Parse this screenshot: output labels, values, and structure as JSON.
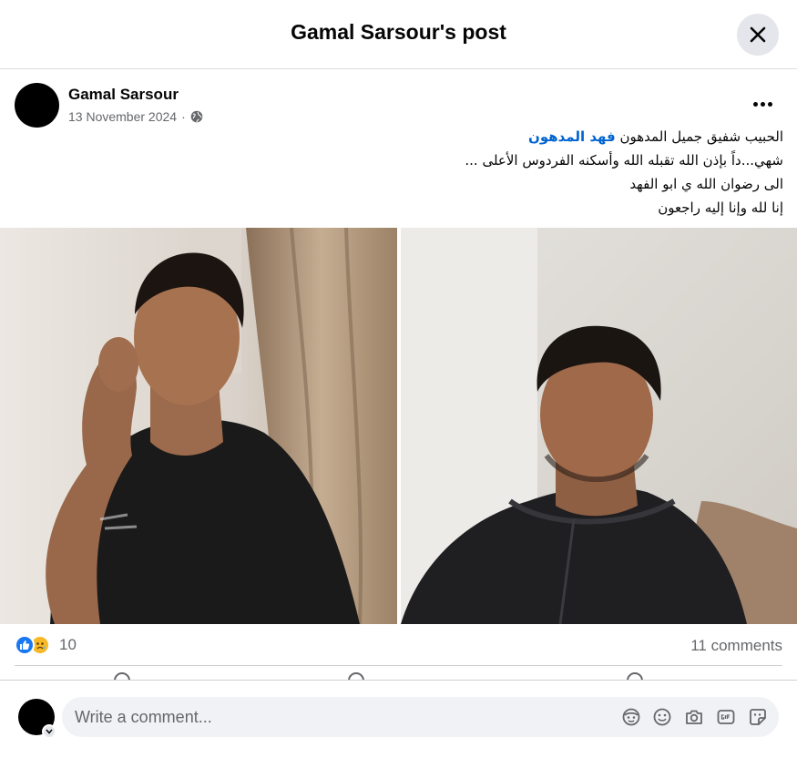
{
  "dialog": {
    "title": "Gamal Sarsour's post"
  },
  "post": {
    "author": "Gamal Sarsour",
    "date": "13 November 2024",
    "separator": "·",
    "privacy_icon": "globe-icon",
    "text_lines": [
      {
        "before": "الحبيب شفيق جميل المدهون ",
        "mention": "فهد المدهون"
      },
      "شهي...داً بإذن الله تقبله الله وأسكنه الفردوس الأعلى ...",
      "الى رضوان الله ي ابو الفهد",
      "إنا لله وإنا إليه راجعون"
    ],
    "photos": [
      {
        "name": "photo-left",
        "subject": "man in black t-shirt holding phone"
      },
      {
        "name": "photo-right",
        "subject": "man in dark hoodie"
      }
    ]
  },
  "stats": {
    "reaction_icons": [
      "like-icon",
      "sad-icon"
    ],
    "reaction_count": "10",
    "comments": "11 comments"
  },
  "composer": {
    "placeholder": "Write a comment...",
    "tools": [
      "avatar-sticker-icon",
      "emoji-icon",
      "camera-icon",
      "gif-icon",
      "sticker-icon"
    ]
  },
  "colors": {
    "accent": "#1877f2",
    "mention": "#0064d1",
    "secondary_text": "#65676b",
    "surface": "#f0f2f5",
    "sad": "#f7b928"
  }
}
